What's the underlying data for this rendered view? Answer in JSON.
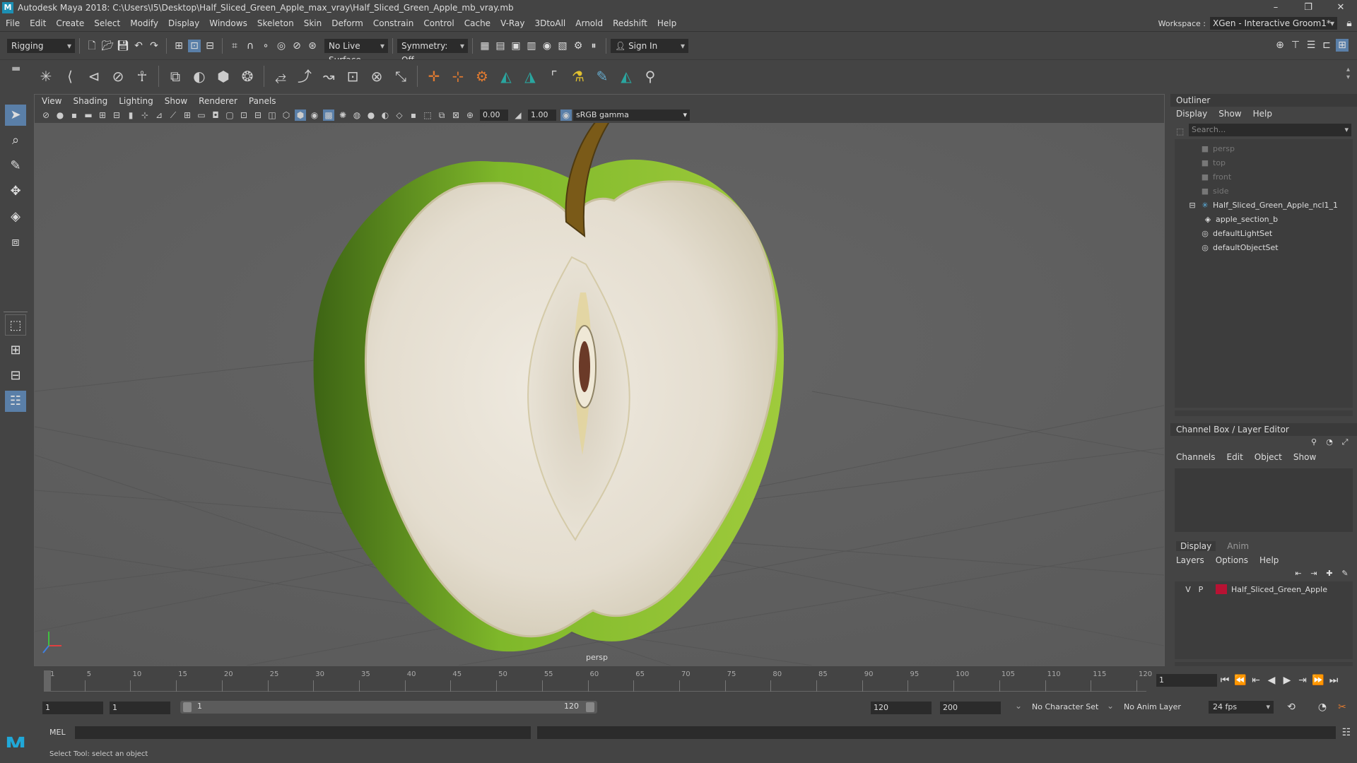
{
  "window": {
    "title": "Autodesk Maya 2018: C:\\Users\\I5\\Desktop\\Half_Sliced_Green_Apple_max_vray\\Half_Sliced_Green_Apple_mb_vray.mb",
    "logo": "M",
    "minimize": "–",
    "restore": "❐",
    "close": "✕"
  },
  "menus": [
    "File",
    "Edit",
    "Create",
    "Select",
    "Modify",
    "Display",
    "Windows",
    "Skeleton",
    "Skin",
    "Deform",
    "Constrain",
    "Control",
    "Cache",
    "V-Ray",
    "3DtoAll",
    "Arnold",
    "Redshift",
    "Help"
  ],
  "workspace": {
    "label": "Workspace :",
    "value": "XGen - Interactive Groom1*"
  },
  "status": {
    "mode": "Rigging",
    "live_surface": "No Live Surface",
    "symmetry": "Symmetry: Off",
    "sign_in": "Sign In"
  },
  "viewport": {
    "menus": [
      "View",
      "Shading",
      "Lighting",
      "Show",
      "Renderer",
      "Panels"
    ],
    "exposure": "0.00",
    "gamma": "1.00",
    "colorspace": "sRGB gamma",
    "camera": "persp"
  },
  "outliner": {
    "title": "Outliner",
    "menus": [
      "Display",
      "Show",
      "Help"
    ],
    "search_placeholder": "Search...",
    "items": [
      {
        "label": "persp",
        "dim": true
      },
      {
        "label": "top",
        "dim": true
      },
      {
        "label": "front",
        "dim": true
      },
      {
        "label": "side",
        "dim": true
      },
      {
        "label": "Half_Sliced_Green_Apple_ncl1_1",
        "dim": false
      },
      {
        "label": "apple_section_b",
        "dim": false
      },
      {
        "label": "defaultLightSet",
        "dim": false
      },
      {
        "label": "defaultObjectSet",
        "dim": false
      }
    ]
  },
  "channelbox": {
    "title": "Channel Box / Layer Editor",
    "menus": [
      "Channels",
      "Edit",
      "Object",
      "Show"
    ],
    "tabs": [
      "Display",
      "Anim"
    ],
    "layer_menus": [
      "Layers",
      "Options",
      "Help"
    ],
    "layer": {
      "v": "V",
      "p": "P",
      "name": "Half_Sliced_Green_Apple",
      "color": "#b81233"
    }
  },
  "timeline": {
    "ticks": [
      "1",
      "5",
      "10",
      "15",
      "20",
      "25",
      "30",
      "35",
      "40",
      "45",
      "50",
      "55",
      "60",
      "65",
      "70",
      "75",
      "80",
      "85",
      "90",
      "95",
      "100",
      "105",
      "110",
      "115",
      "120"
    ],
    "current": "1"
  },
  "range": {
    "start": "1",
    "inner_start": "1",
    "slider_start": "1",
    "slider_end": "120",
    "end": "120",
    "outer_end": "200",
    "character_set": "No Character Set",
    "anim_layer": "No Anim Layer",
    "fps": "24 fps"
  },
  "command": {
    "lang": "MEL"
  },
  "help": {
    "text": "Select Tool: select an object"
  }
}
